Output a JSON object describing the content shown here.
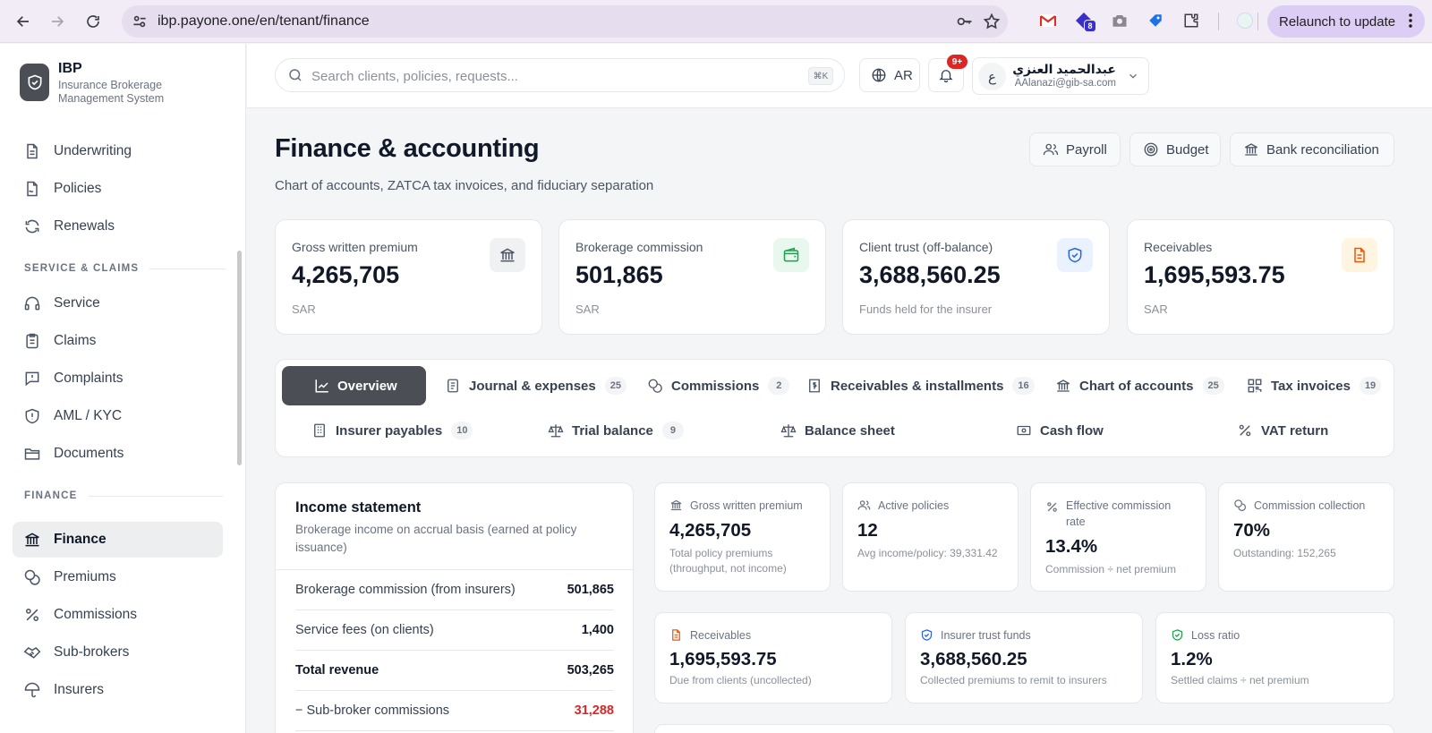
{
  "browser": {
    "url": "ibp.payone.one/en/tenant/finance",
    "ext_badge": "8",
    "relaunch_label": "Relaunch to update"
  },
  "sidebar": {
    "brand": "IBP",
    "brand_sub": "Insurance Brokerage Management System",
    "items_top": [
      {
        "label": "Underwriting",
        "icon": "file-icon"
      },
      {
        "label": "Policies",
        "icon": "file-sign-icon"
      },
      {
        "label": "Renewals",
        "icon": "refresh-icon"
      }
    ],
    "section_service": "SERVICE & CLAIMS",
    "items_service": [
      {
        "label": "Service",
        "icon": "headset-icon"
      },
      {
        "label": "Claims",
        "icon": "clipboard-icon"
      },
      {
        "label": "Complaints",
        "icon": "message-alert-icon"
      },
      {
        "label": "AML / KYC",
        "icon": "shield-alert-icon"
      },
      {
        "label": "Documents",
        "icon": "folder-icon"
      }
    ],
    "section_finance": "FINANCE",
    "items_finance": [
      {
        "label": "Finance",
        "icon": "bank-icon",
        "active": true
      },
      {
        "label": "Premiums",
        "icon": "coins-icon"
      },
      {
        "label": "Commissions",
        "icon": "percent-icon"
      },
      {
        "label": "Sub-brokers",
        "icon": "handshake-icon"
      },
      {
        "label": "Insurers",
        "icon": "umbrella-icon"
      }
    ]
  },
  "topbar": {
    "search_placeholder": "Search clients, policies, requests...",
    "search_shortcut": "⌘K",
    "lang_label": "AR",
    "notif_badge": "9+",
    "user_initial": "ع",
    "user_name": "عبدالحميد العنزي",
    "user_email": "AAlanazi@gib-sa.com"
  },
  "page": {
    "title": "Finance & accounting",
    "subtitle": "Chart of accounts, ZATCA tax invoices, and fiduciary separation",
    "actions": [
      "Payroll",
      "Budget",
      "Bank reconciliation"
    ]
  },
  "stats": [
    {
      "label": "Gross written premium",
      "value": "4,265,705",
      "note": "SAR",
      "icon": "bank-icon",
      "color": "#4b5563",
      "bg": "#f3f4f6"
    },
    {
      "label": "Brokerage commission",
      "value": "501,865",
      "note": "SAR",
      "icon": "wallet-icon",
      "color": "#16a34a",
      "bg": "#ecfdf3"
    },
    {
      "label": "Client trust (off-balance)",
      "value": "3,688,560.25",
      "note": "Funds held for the insurer",
      "icon": "shield-check-icon",
      "color": "#2563eb",
      "bg": "#eef4ff"
    },
    {
      "label": "Receivables",
      "value": "1,695,593.75",
      "note": "SAR",
      "icon": "file-text-icon",
      "color": "#ea580c",
      "bg": "#fff7e6"
    }
  ],
  "tabs": [
    {
      "label": "Overview",
      "count": "",
      "active": true,
      "icon": "chart-line-icon"
    },
    {
      "label": "Journal & expenses",
      "count": "25",
      "icon": "notebook-icon"
    },
    {
      "label": "Commissions",
      "count": "2",
      "icon": "coins-icon"
    },
    {
      "label": "Receivables & installments",
      "count": "16",
      "icon": "receipt-dollar-icon"
    },
    {
      "label": "Chart of accounts",
      "count": "25",
      "icon": "bank-icon"
    },
    {
      "label": "Tax invoices",
      "count": "19",
      "icon": "qr-code-icon"
    },
    {
      "label": "Insurer payables",
      "count": "10",
      "icon": "building-icon"
    },
    {
      "label": "Trial balance",
      "count": "9",
      "icon": "scale-icon"
    },
    {
      "label": "Balance sheet",
      "count": "",
      "icon": "scale-icon"
    },
    {
      "label": "Cash flow",
      "count": "",
      "icon": "banknote-icon"
    },
    {
      "label": "VAT return",
      "count": "",
      "icon": "percent-icon"
    }
  ],
  "income": {
    "title": "Income statement",
    "desc": "Brokerage income on accrual basis (earned at policy issuance)",
    "rows": [
      {
        "label": "Brokerage commission (from insurers)",
        "amount": "501,865"
      },
      {
        "label": "Service fees (on clients)",
        "amount": "1,400"
      },
      {
        "label": "Total revenue",
        "amount": "503,265"
      },
      {
        "label": "− Sub-broker commissions",
        "amount": "31,288"
      }
    ]
  },
  "metrics": [
    {
      "label": "Gross written premium",
      "value": "4,265,705",
      "note": "Total policy premiums (throughput, not income)",
      "icon": "bank-icon"
    },
    {
      "label": "Active policies",
      "value": "12",
      "note": "Avg income/policy: 39,331.42",
      "icon": "users-icon"
    },
    {
      "label": "Effective commission rate",
      "value": "13.4%",
      "note": "Commission ÷ net premium",
      "icon": "percent-icon"
    },
    {
      "label": "Commission collection",
      "value": "70%",
      "note": "Outstanding: 152,265",
      "icon": "coins-icon"
    },
    {
      "label": "Receivables",
      "value": "1,695,593.75",
      "note": "Due from clients (uncollected)",
      "icon": "file-text-icon"
    },
    {
      "label": "Insurer trust funds",
      "value": "3,688,560.25",
      "note": "Collected premiums to remit to insurers",
      "icon": "shield-check-icon"
    },
    {
      "label": "Loss ratio",
      "value": "1.2%",
      "note": "Settled claims ÷ net premium",
      "icon": "shield-check-icon"
    }
  ]
}
